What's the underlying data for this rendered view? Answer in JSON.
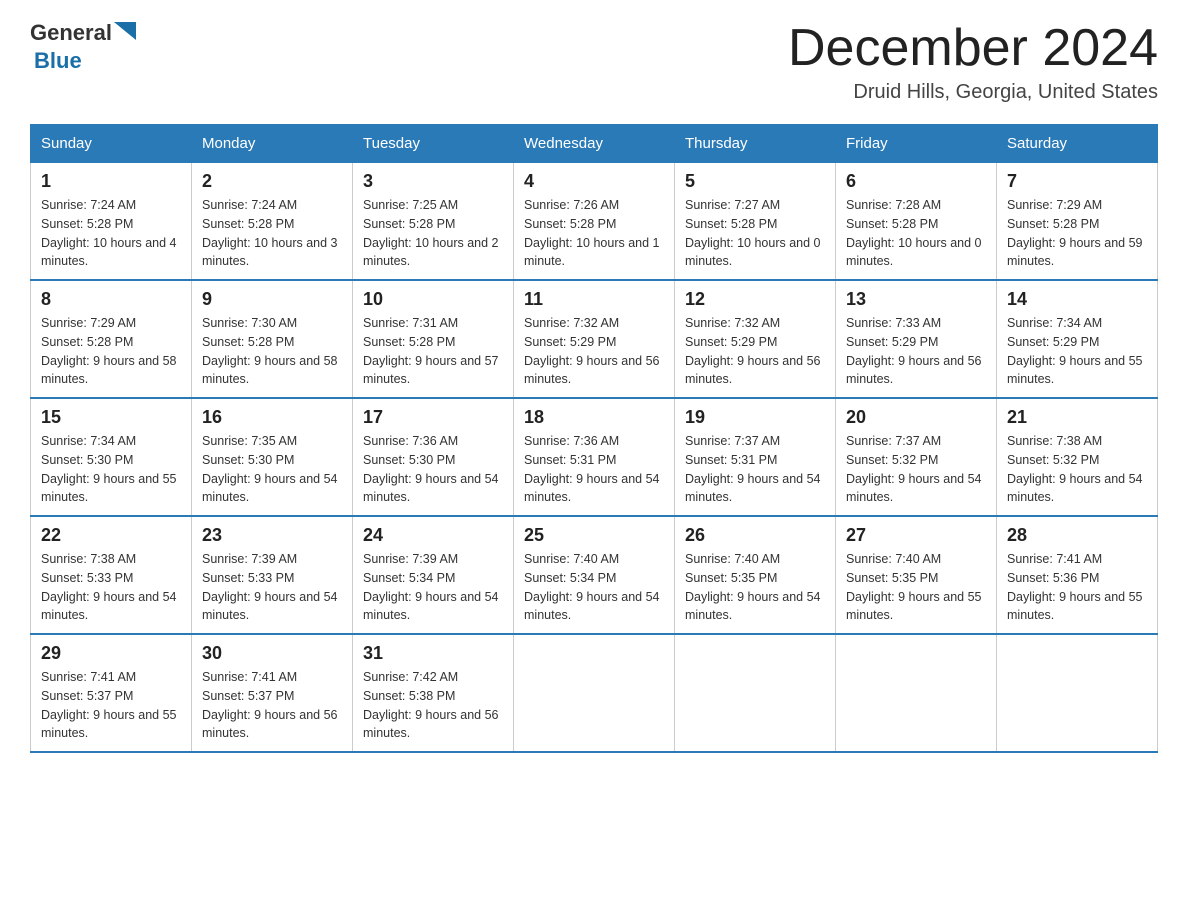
{
  "header": {
    "logo_general": "General",
    "logo_blue": "Blue",
    "month_title": "December 2024",
    "location": "Druid Hills, Georgia, United States"
  },
  "weekdays": [
    "Sunday",
    "Monday",
    "Tuesday",
    "Wednesday",
    "Thursday",
    "Friday",
    "Saturday"
  ],
  "weeks": [
    [
      {
        "day": "1",
        "sunrise": "7:24 AM",
        "sunset": "5:28 PM",
        "daylight": "10 hours and 4 minutes."
      },
      {
        "day": "2",
        "sunrise": "7:24 AM",
        "sunset": "5:28 PM",
        "daylight": "10 hours and 3 minutes."
      },
      {
        "day": "3",
        "sunrise": "7:25 AM",
        "sunset": "5:28 PM",
        "daylight": "10 hours and 2 minutes."
      },
      {
        "day": "4",
        "sunrise": "7:26 AM",
        "sunset": "5:28 PM",
        "daylight": "10 hours and 1 minute."
      },
      {
        "day": "5",
        "sunrise": "7:27 AM",
        "sunset": "5:28 PM",
        "daylight": "10 hours and 0 minutes."
      },
      {
        "day": "6",
        "sunrise": "7:28 AM",
        "sunset": "5:28 PM",
        "daylight": "10 hours and 0 minutes."
      },
      {
        "day": "7",
        "sunrise": "7:29 AM",
        "sunset": "5:28 PM",
        "daylight": "9 hours and 59 minutes."
      }
    ],
    [
      {
        "day": "8",
        "sunrise": "7:29 AM",
        "sunset": "5:28 PM",
        "daylight": "9 hours and 58 minutes."
      },
      {
        "day": "9",
        "sunrise": "7:30 AM",
        "sunset": "5:28 PM",
        "daylight": "9 hours and 58 minutes."
      },
      {
        "day": "10",
        "sunrise": "7:31 AM",
        "sunset": "5:28 PM",
        "daylight": "9 hours and 57 minutes."
      },
      {
        "day": "11",
        "sunrise": "7:32 AM",
        "sunset": "5:29 PM",
        "daylight": "9 hours and 56 minutes."
      },
      {
        "day": "12",
        "sunrise": "7:32 AM",
        "sunset": "5:29 PM",
        "daylight": "9 hours and 56 minutes."
      },
      {
        "day": "13",
        "sunrise": "7:33 AM",
        "sunset": "5:29 PM",
        "daylight": "9 hours and 56 minutes."
      },
      {
        "day": "14",
        "sunrise": "7:34 AM",
        "sunset": "5:29 PM",
        "daylight": "9 hours and 55 minutes."
      }
    ],
    [
      {
        "day": "15",
        "sunrise": "7:34 AM",
        "sunset": "5:30 PM",
        "daylight": "9 hours and 55 minutes."
      },
      {
        "day": "16",
        "sunrise": "7:35 AM",
        "sunset": "5:30 PM",
        "daylight": "9 hours and 54 minutes."
      },
      {
        "day": "17",
        "sunrise": "7:36 AM",
        "sunset": "5:30 PM",
        "daylight": "9 hours and 54 minutes."
      },
      {
        "day": "18",
        "sunrise": "7:36 AM",
        "sunset": "5:31 PM",
        "daylight": "9 hours and 54 minutes."
      },
      {
        "day": "19",
        "sunrise": "7:37 AM",
        "sunset": "5:31 PM",
        "daylight": "9 hours and 54 minutes."
      },
      {
        "day": "20",
        "sunrise": "7:37 AM",
        "sunset": "5:32 PM",
        "daylight": "9 hours and 54 minutes."
      },
      {
        "day": "21",
        "sunrise": "7:38 AM",
        "sunset": "5:32 PM",
        "daylight": "9 hours and 54 minutes."
      }
    ],
    [
      {
        "day": "22",
        "sunrise": "7:38 AM",
        "sunset": "5:33 PM",
        "daylight": "9 hours and 54 minutes."
      },
      {
        "day": "23",
        "sunrise": "7:39 AM",
        "sunset": "5:33 PM",
        "daylight": "9 hours and 54 minutes."
      },
      {
        "day": "24",
        "sunrise": "7:39 AM",
        "sunset": "5:34 PM",
        "daylight": "9 hours and 54 minutes."
      },
      {
        "day": "25",
        "sunrise": "7:40 AM",
        "sunset": "5:34 PM",
        "daylight": "9 hours and 54 minutes."
      },
      {
        "day": "26",
        "sunrise": "7:40 AM",
        "sunset": "5:35 PM",
        "daylight": "9 hours and 54 minutes."
      },
      {
        "day": "27",
        "sunrise": "7:40 AM",
        "sunset": "5:35 PM",
        "daylight": "9 hours and 55 minutes."
      },
      {
        "day": "28",
        "sunrise": "7:41 AM",
        "sunset": "5:36 PM",
        "daylight": "9 hours and 55 minutes."
      }
    ],
    [
      {
        "day": "29",
        "sunrise": "7:41 AM",
        "sunset": "5:37 PM",
        "daylight": "9 hours and 55 minutes."
      },
      {
        "day": "30",
        "sunrise": "7:41 AM",
        "sunset": "5:37 PM",
        "daylight": "9 hours and 56 minutes."
      },
      {
        "day": "31",
        "sunrise": "7:42 AM",
        "sunset": "5:38 PM",
        "daylight": "9 hours and 56 minutes."
      },
      null,
      null,
      null,
      null
    ]
  ]
}
